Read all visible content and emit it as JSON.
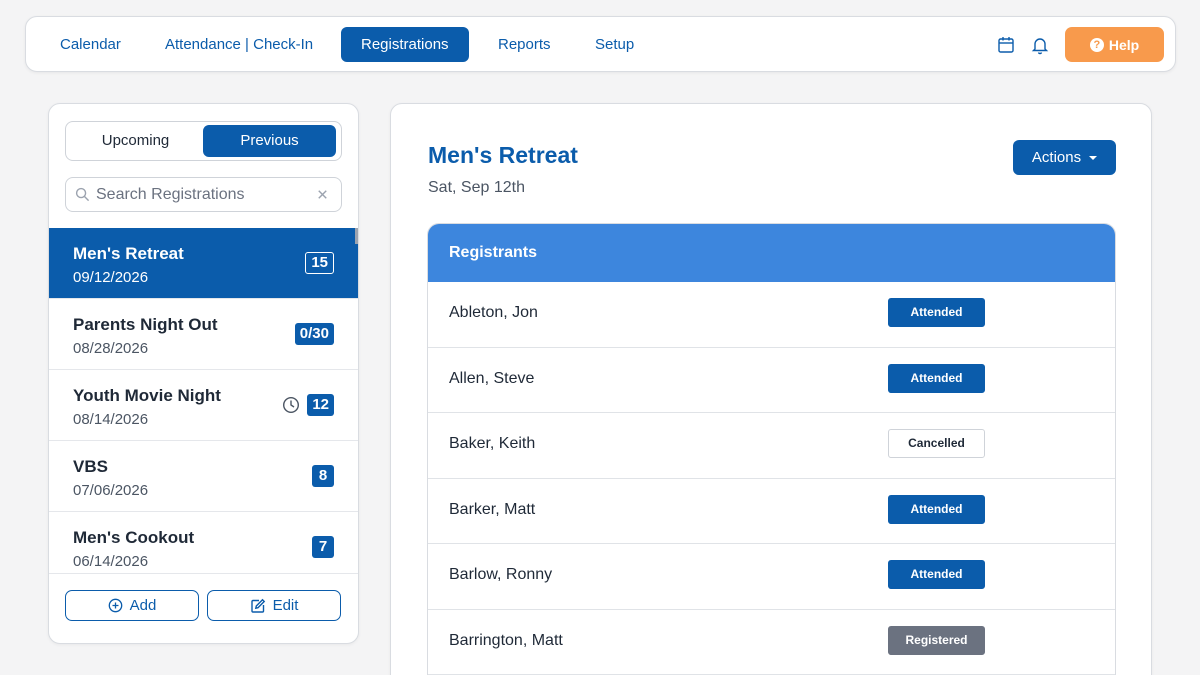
{
  "nav": {
    "items": [
      {
        "label": "Calendar",
        "active": false
      },
      {
        "label": "Attendance | Check-In",
        "active": false
      },
      {
        "label": "Registrations",
        "active": true
      },
      {
        "label": "Reports",
        "active": false
      },
      {
        "label": "Setup",
        "active": false
      }
    ],
    "icons": [
      "calendar-icon",
      "bell-icon"
    ],
    "help_label": "Help",
    "help_color": "#f89a4c",
    "accent_color": "#0b5cab"
  },
  "sidebar": {
    "toggle": {
      "upcoming": "Upcoming",
      "previous": "Previous",
      "selected": "Previous"
    },
    "search": {
      "placeholder": "Search Registrations",
      "value": ""
    },
    "items": [
      {
        "name": "Men's Retreat",
        "date": "09/12/2026",
        "count": "15",
        "active": true
      },
      {
        "name": "Parents Night Out",
        "date": "08/28/2026",
        "count": "0/30",
        "active": false
      },
      {
        "name": "Youth Movie Night",
        "date": "08/14/2026",
        "count": "12",
        "active": false,
        "icon": "clock-icon"
      },
      {
        "name": "VBS",
        "date": "07/06/2026",
        "count": "8",
        "active": false
      },
      {
        "name": "Men's Cookout",
        "date": "06/14/2026",
        "count": "7",
        "active": false
      }
    ],
    "add_label": "Add",
    "edit_label": "Edit"
  },
  "main": {
    "title": "Men's Retreat",
    "date": "Sat, Sep 12th",
    "actions_label": "Actions",
    "table_header": "Registrants",
    "registrants": [
      {
        "name": "Ableton, Jon",
        "status": "Attended"
      },
      {
        "name": "Allen, Steve",
        "status": "Attended"
      },
      {
        "name": "Baker, Keith",
        "status": "Cancelled"
      },
      {
        "name": "Barker, Matt",
        "status": "Attended"
      },
      {
        "name": "Barlow, Ronny",
        "status": "Attended"
      },
      {
        "name": "Barrington, Matt",
        "status": "Registered"
      }
    ]
  }
}
